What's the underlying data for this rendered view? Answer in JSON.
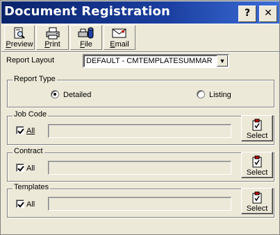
{
  "window": {
    "title": "Document Registration",
    "help_label": "?",
    "close_label": "✕"
  },
  "toolbar": {
    "preview_prefix": "",
    "preview_mnemonic": "P",
    "preview_rest": "review",
    "print_mnemonic": "P",
    "print_rest": "rint",
    "file_mnemonic": "F",
    "file_rest": "ile",
    "email_mnemonic": "E",
    "email_rest": "mail"
  },
  "report_layout": {
    "label": "Report Layout",
    "value": "DEFAULT - CMTEMPLATESUMMAR"
  },
  "report_type": {
    "label": "Report Type",
    "options": [
      {
        "label": "Detailed",
        "selected": true
      },
      {
        "label": "Listing",
        "selected": false
      }
    ]
  },
  "sections": [
    {
      "label": "Job Code",
      "all_label": "All",
      "all_checked": true,
      "value": "",
      "select_label": "Select",
      "underline_all": true
    },
    {
      "label": "Contract",
      "all_label": "All",
      "all_checked": true,
      "value": "",
      "select_label": "Select",
      "underline_all": false
    },
    {
      "label": "Templates",
      "all_label": "All",
      "all_checked": true,
      "value": "",
      "select_label": "Select",
      "underline_all": false
    }
  ],
  "colors": {
    "title_bar": "#0a246a",
    "face": "#ece9d8"
  },
  "icons": {
    "preview": "magnifier-page-icon",
    "print": "printer-icon",
    "file": "file-export-icon",
    "email": "envelope-icon",
    "select": "clipboard-check-icon"
  }
}
